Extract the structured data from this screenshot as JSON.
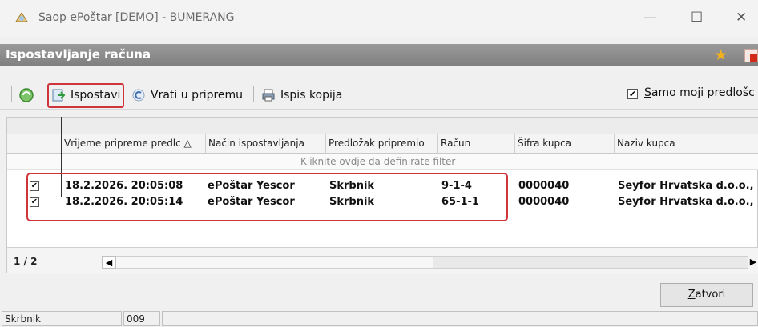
{
  "window": {
    "title": "Saop ePoštar [DEMO] - BUMERANG",
    "controls": {
      "minimize": "—",
      "maximize": "☐",
      "close": "✕"
    }
  },
  "subheader": {
    "title": "Ispostavljanje računa",
    "star_icon": "★"
  },
  "toolbar": {
    "ispostavi_label": "Ispostavi",
    "vrati_label": "Vrati u pripremu",
    "ispis_label": "Ispis kopija",
    "samo_check": "✔",
    "samo_label_first": "S",
    "samo_label_rest": "amo moji predlošc"
  },
  "grid": {
    "columns": [
      "Vrijeme pripreme predlc △",
      "Način ispostavljanja",
      "Predložak pripremio",
      "Račun",
      "Šifra kupca",
      "Naziv kupca"
    ],
    "filter_text": "Kliknite ovdje da definirate filter",
    "rows": [
      {
        "check": "✔",
        "time": "18.2.2026. 20:05:08",
        "method": "ePoštar Yescor",
        "template": "Skrbnik",
        "invoice": "9-1-4",
        "customer_code": "0000040",
        "customer_name": "Seyfor Hrvatska d.o.o., :"
      },
      {
        "check": "✔",
        "time": "18.2.2026. 20:05:14",
        "method": "ePoštar Yescor",
        "template": "Skrbnik",
        "invoice": "65-1-1",
        "customer_code": "0000040",
        "customer_name": "Seyfor Hrvatska d.o.o., :"
      }
    ],
    "pager": "1 / 2",
    "scroll_left": "◀",
    "scroll_right": "▶"
  },
  "buttons": {
    "zatvori_first": "Z",
    "zatvori_rest": "atvori"
  },
  "status": {
    "user": "Skrbnik",
    "code": "009"
  },
  "colors": {
    "accent_red": "#d0343b",
    "header_gray": "#8a8a8a"
  }
}
